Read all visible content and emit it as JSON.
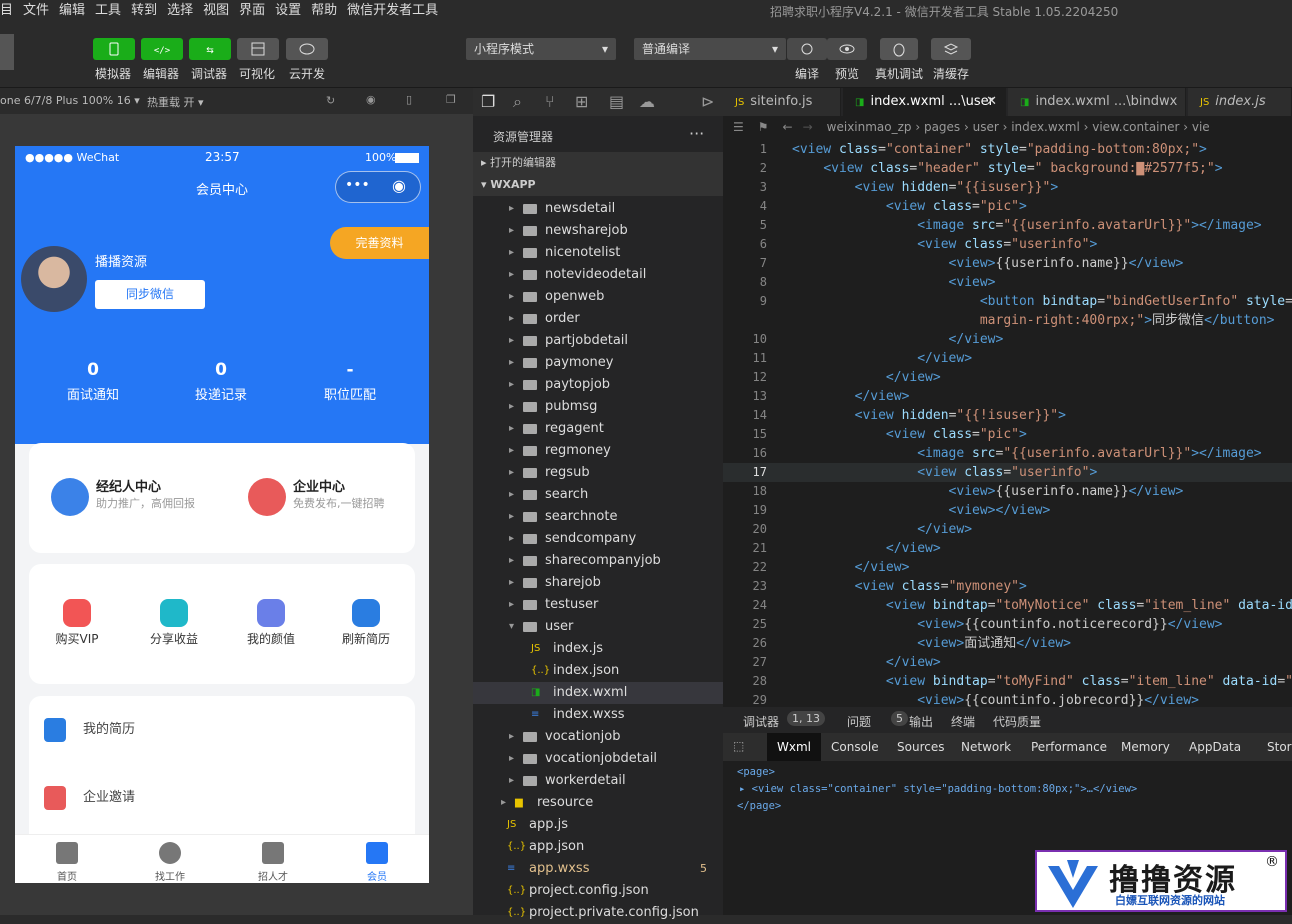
{
  "menubar": {
    "items": [
      "目",
      "文件",
      "编辑",
      "工具",
      "转到",
      "选择",
      "视图",
      "界面",
      "设置",
      "帮助",
      "微信开发者工具"
    ],
    "title": "招聘求职小程序V4.2.1 - 微信开发者工具 Stable 1.05.2204250"
  },
  "toolbar": {
    "simulator": "模拟器",
    "editor": "编辑器",
    "debugger": "调试器",
    "visual": "可视化",
    "cloud": "云开发",
    "mode": "小程序模式",
    "compile_mode": "普通编译",
    "compile": "编译",
    "preview": "预览",
    "real_debug": "真机调试",
    "clear_cache": "清缓存"
  },
  "devbar": {
    "device": "one 6/7/8 Plus 100% 16 ▾",
    "hotreload": "热重载 开 ▾"
  },
  "phone": {
    "status": {
      "carrier": "●●●●● WeChat",
      "time": "23:57",
      "battery": "100%"
    },
    "nav_title": "会员中心",
    "complete_btn": "完善资料",
    "user_name": "播播资源",
    "sync_btn": "同步微信",
    "stats": [
      {
        "value": "0",
        "label": "面试通知"
      },
      {
        "value": "0",
        "label": "投递记录"
      },
      {
        "value": "-",
        "label": "职位匹配"
      }
    ],
    "centers": [
      {
        "title": "经纪人中心",
        "sub": "助力推广，高佣回报"
      },
      {
        "title": "企业中心",
        "sub": "免费发布,一键招聘"
      }
    ],
    "grid": [
      {
        "label": "购买VIP",
        "icon": "vip-icon"
      },
      {
        "label": "分享收益",
        "icon": "share-icon"
      },
      {
        "label": "我的颜值",
        "icon": "face-icon"
      },
      {
        "label": "刷新简历",
        "icon": "refresh-icon"
      }
    ],
    "list": [
      {
        "label": "我的简历"
      },
      {
        "label": "企业邀请"
      }
    ],
    "tabbar": [
      {
        "label": "首页"
      },
      {
        "label": "找工作"
      },
      {
        "label": "招人才"
      },
      {
        "label": "会员"
      }
    ]
  },
  "explorer": {
    "title": "资源管理器",
    "sections": [
      "打开的编辑器",
      "WXAPP"
    ],
    "folders": [
      "newsdetail",
      "newsharejob",
      "nicenotelist",
      "notevideodetail",
      "openweb",
      "order",
      "partjobdetail",
      "paymoney",
      "paytopjob",
      "pubmsg",
      "regagent",
      "regmoney",
      "regsub",
      "search",
      "searchnote",
      "sendcompany",
      "sharecompanyjob",
      "sharejob",
      "testuser",
      "user"
    ],
    "user_files": [
      "index.js",
      "index.json",
      "index.wxml",
      "index.wxss"
    ],
    "folders2": [
      "vocationjob",
      "vocationjobdetail",
      "workerdetail"
    ],
    "root": [
      {
        "name": "resource",
        "kind": "folder"
      },
      {
        "name": "app.js",
        "kind": "js"
      },
      {
        "name": "app.json",
        "kind": "json"
      },
      {
        "name": "app.wxss",
        "kind": "wxss",
        "badge": "5"
      },
      {
        "name": "project.config.json",
        "kind": "json"
      },
      {
        "name": "project.private.config.json",
        "kind": "json"
      }
    ]
  },
  "editor": {
    "tabs": [
      "siteinfo.js",
      "index.wxml ...\\user",
      "index.wxml ...\\bindwx",
      "index.js"
    ],
    "crumbs": "weixinmao_zp › pages › user › index.wxml › view.container › vie",
    "lines": [
      {
        "n": "1",
        "html": "<span class=t>&lt;view</span> <span class=a>class</span>=<span class=s>\"container\"</span> <span class=a>style</span>=<span class=s>\"padding-bottom:80px;\"</span><span class=t>&gt;</span>"
      },
      {
        "n": "2",
        "html": "    <span class=t>&lt;view</span> <span class=a>class</span>=<span class=s>\"header\"</span> <span class=a>style</span>=<span class=s>\" background:▇#2577f5;\"</span><span class=t>&gt;</span>"
      },
      {
        "n": "3",
        "html": "        <span class=t>&lt;view</span> <span class=a>hidden</span>=<span class=s>\"{{isuser}}\"</span><span class=t>&gt;</span>"
      },
      {
        "n": "4",
        "html": "            <span class=t>&lt;view</span> <span class=a>class</span>=<span class=s>\"pic\"</span><span class=t>&gt;</span>"
      },
      {
        "n": "5",
        "html": "                <span class=t>&lt;image</span> <span class=a>src</span>=<span class=s>\"{{userinfo.avatarUrl}}\"</span><span class=t>&gt;&lt;/image&gt;</span>"
      },
      {
        "n": "6",
        "html": "                <span class=t>&lt;view</span> <span class=a>class</span>=<span class=s>\"userinfo\"</span><span class=t>&gt;</span>"
      },
      {
        "n": "7",
        "html": "                    <span class=t>&lt;view&gt;</span>{{userinfo.name}}<span class=t>&lt;/view&gt;</span>"
      },
      {
        "n": "8",
        "html": "                    <span class=t>&lt;view&gt;</span>"
      },
      {
        "n": "9",
        "html": "                        <span class=t>&lt;button</span> <span class=a>bindtap</span>=<span class=s>\"bindGetUserInfo\"</span> <span class=a>style</span>=<span class=s>\"</span>"
      },
      {
        "n": "",
        "html": "                        <span class=s>margin-right:400rpx;\"</span><span class=t>&gt;</span>同步微信<span class=t>&lt;/button&gt;</span>"
      },
      {
        "n": "10",
        "html": "                    <span class=t>&lt;/view&gt;</span>"
      },
      {
        "n": "11",
        "html": "                <span class=t>&lt;/view&gt;</span>"
      },
      {
        "n": "12",
        "html": "            <span class=t>&lt;/view&gt;</span>"
      },
      {
        "n": "13",
        "html": "        <span class=t>&lt;/view&gt;</span>"
      },
      {
        "n": "14",
        "html": "        <span class=t>&lt;view</span> <span class=a>hidden</span>=<span class=s>\"{{!isuser}}\"</span><span class=t>&gt;</span>"
      },
      {
        "n": "15",
        "html": "            <span class=t>&lt;view</span> <span class=a>class</span>=<span class=s>\"pic\"</span><span class=t>&gt;</span>"
      },
      {
        "n": "16",
        "html": "                <span class=t>&lt;image</span> <span class=a>src</span>=<span class=s>\"{{userinfo.avatarUrl}}\"</span><span class=t>&gt;&lt;/image&gt;</span>"
      },
      {
        "n": "17",
        "html": "                <span class=t>&lt;view</span> <span class=a>class</span>=<span class=s>\"userinfo\"</span><span class=t>&gt;</span>"
      },
      {
        "n": "18",
        "html": "                    <span class=t>&lt;view&gt;</span>{{userinfo.name}}<span class=t>&lt;/view&gt;</span>"
      },
      {
        "n": "19",
        "html": "                    <span class=t>&lt;view&gt;&lt;/view&gt;</span>"
      },
      {
        "n": "20",
        "html": "                <span class=t>&lt;/view&gt;</span>"
      },
      {
        "n": "21",
        "html": "            <span class=t>&lt;/view&gt;</span>"
      },
      {
        "n": "22",
        "html": "        <span class=t>&lt;/view&gt;</span>"
      },
      {
        "n": "23",
        "html": "        <span class=t>&lt;view</span> <span class=a>class</span>=<span class=s>\"mymoney\"</span><span class=t>&gt;</span>"
      },
      {
        "n": "24",
        "html": "            <span class=t>&lt;view</span> <span class=a>bindtap</span>=<span class=s>\"toMyNotice\"</span> <span class=a>class</span>=<span class=s>\"item_line\"</span> <span class=a>data-id</span>=<span class=s>\"</span>"
      },
      {
        "n": "25",
        "html": "                <span class=t>&lt;view&gt;</span>{{countinfo.noticerecord}}<span class=t>&lt;/view&gt;</span>"
      },
      {
        "n": "26",
        "html": "                <span class=t>&lt;view&gt;</span>面试通知<span class=t>&lt;/view&gt;</span>"
      },
      {
        "n": "27",
        "html": "            <span class=t>&lt;/view&gt;</span>"
      },
      {
        "n": "28",
        "html": "            <span class=t>&lt;view</span> <span class=a>bindtap</span>=<span class=s>\"toMyFind\"</span> <span class=a>class</span>=<span class=s>\"item_line\"</span> <span class=a>data-id</span>=<span class=s>\"-</span>"
      },
      {
        "n": "29",
        "html": "                <span class=t>&lt;view&gt;</span>{{countinfo.jobrecord}}<span class=t>&lt;/view&gt;</span>"
      }
    ]
  },
  "debug": {
    "tabs1": [
      {
        "label": "调试器",
        "badge": "1, 13"
      },
      {
        "label": "问题",
        "badge": "5"
      },
      {
        "label": "输出"
      },
      {
        "label": "终端"
      },
      {
        "label": "代码质量"
      }
    ],
    "tabs2": [
      "Wxml",
      "Console",
      "Sources",
      "Network",
      "Performance",
      "Memory",
      "AppData",
      "Storag"
    ],
    "lines": [
      "<page>",
      "▸ <view class=\"container\" style=\"padding-bottom:80px;\">…</view>",
      "</page>"
    ]
  },
  "watermark": {
    "title": "撸撸资源",
    "sub": "白嫖互联网资源的网站",
    "reg": "®"
  },
  "colors": {
    "brand_blue": "#2577f5",
    "green": "#1aad19",
    "orange": "#f5a623"
  }
}
